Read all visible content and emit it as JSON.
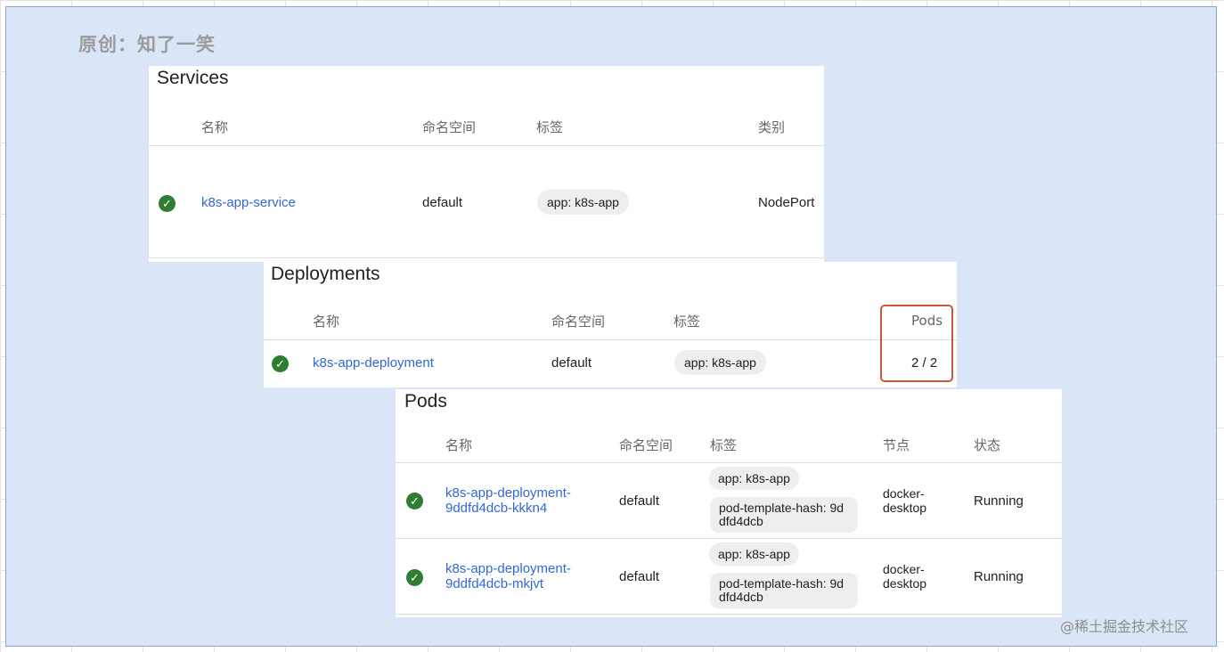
{
  "caption": "原创：知了一笑",
  "watermark": "@稀土掘金技术社区",
  "services": {
    "title": "Services",
    "headers": {
      "name": "名称",
      "namespace": "命名空间",
      "labels": "标签",
      "type": "类别"
    },
    "row": {
      "status": "ok",
      "name": "k8s-app-service",
      "namespace": "default",
      "label": "app: k8s-app",
      "type": "NodePort"
    }
  },
  "deployments": {
    "title": "Deployments",
    "headers": {
      "name": "名称",
      "namespace": "命名空间",
      "labels": "标签",
      "pods": "Pods"
    },
    "row": {
      "status": "ok",
      "name": "k8s-app-deployment",
      "namespace": "default",
      "label": "app: k8s-app",
      "pods": "2 / 2"
    }
  },
  "pods": {
    "title": "Pods",
    "headers": {
      "name": "名称",
      "namespace": "命名空间",
      "labels": "标签",
      "node": "节点",
      "status": "状态"
    },
    "rows": [
      {
        "status": "ok",
        "name_line1": "k8s-app-deployment-",
        "name_line2": "9ddfd4dcb-kkkn4",
        "namespace": "default",
        "label1": "app: k8s-app",
        "label2": "pod-template-hash: 9ddfd4dcb",
        "node_line1": "docker-",
        "node_line2": "desktop",
        "state": "Running"
      },
      {
        "status": "ok",
        "name_line1": "k8s-app-deployment-",
        "name_line2": "9ddfd4dcb-mkjvt",
        "namespace": "default",
        "label1": "app: k8s-app",
        "label2": "pod-template-hash: 9ddfd4dcb",
        "node_line1": "docker-",
        "node_line2": "desktop",
        "state": "Running"
      }
    ]
  },
  "icons": {
    "status_ok": "check-circle-icon"
  },
  "colors": {
    "link": "#3367d6",
    "ok": "#2e7d32",
    "highlight": "#c9583a",
    "background": "#dae5f8"
  }
}
